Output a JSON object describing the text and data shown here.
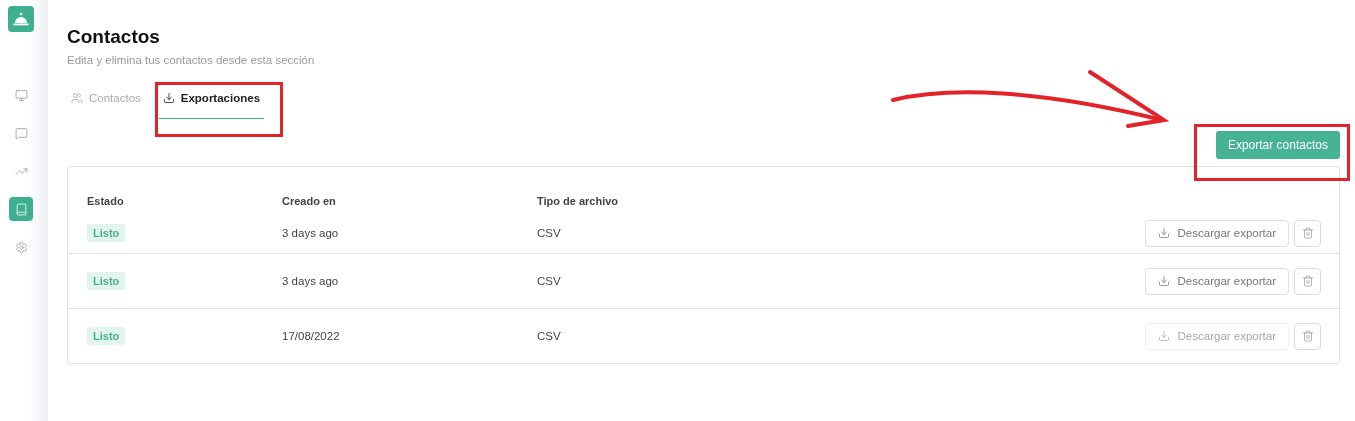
{
  "sidebar": {
    "items": [
      {
        "kind": "monitor",
        "selected": false
      },
      {
        "kind": "chat",
        "selected": false
      },
      {
        "kind": "trend",
        "selected": false
      },
      {
        "kind": "book",
        "selected": true
      },
      {
        "kind": "gear",
        "selected": false
      }
    ]
  },
  "header": {
    "title": "Contactos",
    "subtitle": "Edita y elimina tus contactos desde esta sección"
  },
  "tabs": [
    {
      "label": "Contactos",
      "kind": "users",
      "selected": false
    },
    {
      "label": "Exportaciones",
      "kind": "download",
      "selected": true
    }
  ],
  "export_button": "Exportar contactos",
  "table": {
    "columns": [
      "Estado",
      "Creado en",
      "Tipo de archivo"
    ],
    "rows": [
      {
        "status": "Listo",
        "created": "3 days ago",
        "type": "CSV",
        "download": "Descargar exportar",
        "download_disabled": false
      },
      {
        "status": "Listo",
        "created": "3 days ago",
        "type": "CSV",
        "download": "Descargar exportar",
        "download_disabled": false
      },
      {
        "status": "Listo",
        "created": "17/08/2022",
        "type": "CSV",
        "download": "Descargar exportar",
        "download_disabled": true
      }
    ]
  }
}
